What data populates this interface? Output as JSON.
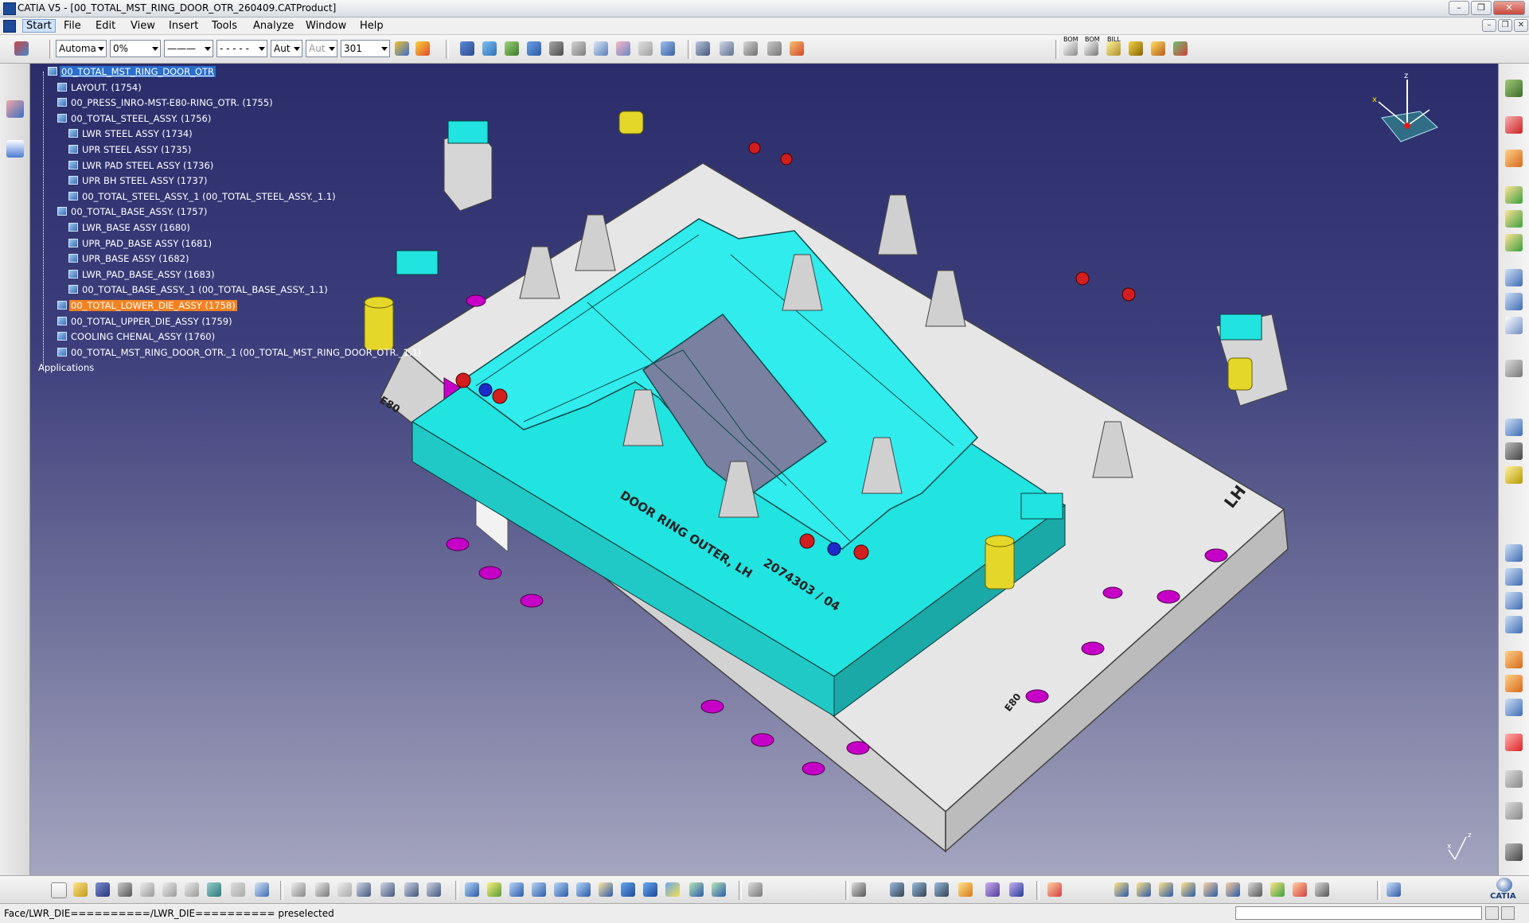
{
  "window": {
    "title": "CATIA V5 - [00_TOTAL_MST_RING_DOOR_OTR_260409.CATProduct]"
  },
  "menu": {
    "items": [
      "Start",
      "File",
      "Edit",
      "View",
      "Insert",
      "Tools",
      "Analyze",
      "Window",
      "Help"
    ]
  },
  "toolbar": {
    "color_combo": "Automa",
    "transparency_combo": "0%",
    "line_weight_combo": "———",
    "line_type_combo": "- - - - -",
    "layer_combo": "Aut",
    "point_combo": "Aut",
    "render_combo": "301",
    "bom_labels": [
      "BOM",
      "BOM",
      "BILL"
    ]
  },
  "tree": {
    "items": [
      {
        "label": "00_TOTAL_MST_RING_DOOR_OTR",
        "level": 0,
        "state": "selected"
      },
      {
        "label": "LAYOUT. (1754)",
        "level": 1,
        "state": ""
      },
      {
        "label": "00_PRESS_INRO-MST-E80-RING_OTR. (1755)",
        "level": 1,
        "state": ""
      },
      {
        "label": "00_TOTAL_STEEL_ASSY. (1756)",
        "level": 1,
        "state": ""
      },
      {
        "label": "LWR STEEL ASSY (1734)",
        "level": 2,
        "state": ""
      },
      {
        "label": "UPR STEEL ASSY (1735)",
        "level": 2,
        "state": ""
      },
      {
        "label": "LWR PAD STEEL ASSY (1736)",
        "level": 2,
        "state": ""
      },
      {
        "label": "UPR BH STEEL ASSY (1737)",
        "level": 2,
        "state": ""
      },
      {
        "label": "00_TOTAL_STEEL_ASSY._1 (00_TOTAL_STEEL_ASSY._1.1)",
        "level": 2,
        "state": ""
      },
      {
        "label": "00_TOTAL_BASE_ASSY. (1757)",
        "level": 1,
        "state": ""
      },
      {
        "label": "LWR_BASE ASSY (1680)",
        "level": 2,
        "state": ""
      },
      {
        "label": "UPR_PAD_BASE ASSY (1681)",
        "level": 2,
        "state": ""
      },
      {
        "label": "UPR_BASE ASSY (1682)",
        "level": 2,
        "state": ""
      },
      {
        "label": "LWR_PAD_BASE_ASSY (1683)",
        "level": 2,
        "state": ""
      },
      {
        "label": "00_TOTAL_BASE_ASSY._1 (00_TOTAL_BASE_ASSY._1.1)",
        "level": 2,
        "state": ""
      },
      {
        "label": "00_TOTAL_LOWER_DIE_ASSY (1758)",
        "level": 1,
        "state": "highlight"
      },
      {
        "label": "00_TOTAL_UPPER_DIE_ASSY (1759)",
        "level": 1,
        "state": ""
      },
      {
        "label": "COOLING CHENAL_ASSY (1760)",
        "level": 1,
        "state": ""
      },
      {
        "label": "00_TOTAL_MST_RING_DOOR_OTR._1 (00_TOTAL_MST_RING_DOOR_OTR._1.1)",
        "level": 1,
        "state": ""
      },
      {
        "label": "Applications",
        "level": 0,
        "state": ""
      }
    ]
  },
  "model": {
    "engraving_main": "DOOR RING OUTER, LH",
    "engraving_number": "2074303 / 04",
    "engraving_e80_left": "E80",
    "engraving_e80_right": "E80",
    "engraving_lh": "LH"
  },
  "compass": {
    "z_label": "z",
    "x_label": "x"
  },
  "axis_small": {
    "z_label": "z",
    "x_label": "x"
  },
  "logo": {
    "text": "CATIA"
  },
  "status": {
    "text": "Face/LWR_DIE==========/LWR_DIE========== preselected"
  },
  "colors": {
    "cyan": "#21e3e0",
    "magenta": "#c600c6",
    "plate": "#e6e6e6",
    "tree_selection": "#2a6ecf",
    "tree_highlight": "#f58220"
  }
}
